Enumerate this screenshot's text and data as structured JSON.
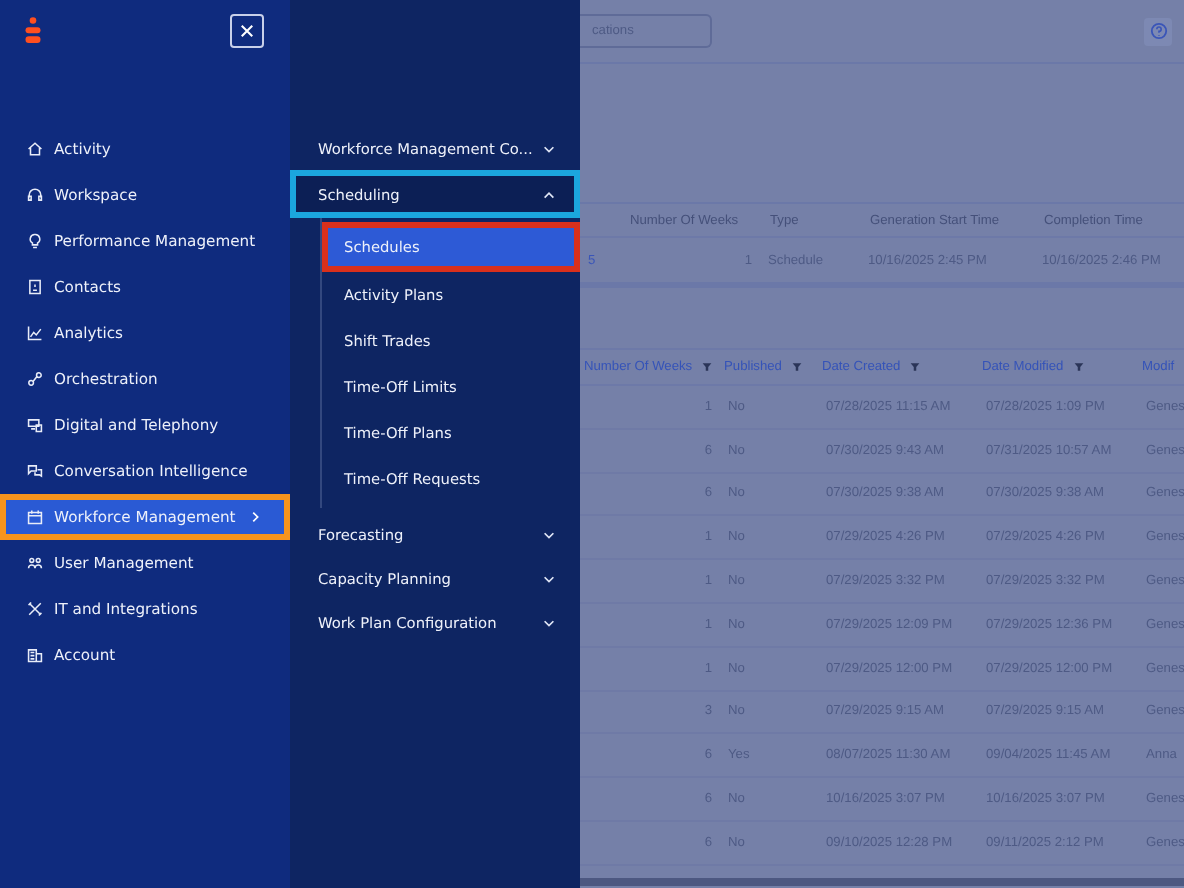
{
  "nav": {
    "items": [
      {
        "label": "Activity",
        "selected": false
      },
      {
        "label": "Workspace",
        "selected": false
      },
      {
        "label": "Performance Management",
        "selected": false
      },
      {
        "label": "Contacts",
        "selected": false
      },
      {
        "label": "Analytics",
        "selected": false
      },
      {
        "label": "Orchestration",
        "selected": false
      },
      {
        "label": "Digital and Telephony",
        "selected": false
      },
      {
        "label": "Conversation Intelligence",
        "selected": false
      },
      {
        "label": "Workforce Management",
        "selected": true,
        "color": "#f7941d"
      },
      {
        "label": "User Management",
        "selected": false
      },
      {
        "label": "IT and Integrations",
        "selected": false
      },
      {
        "label": "Account",
        "selected": false
      }
    ]
  },
  "submenu": {
    "groups": [
      {
        "label": "Workforce Management Co...",
        "expanded": false
      },
      {
        "label": "Scheduling",
        "expanded": true,
        "color": "#1ba6de",
        "children": [
          {
            "label": "Schedules",
            "selected": true,
            "color": "#d9301c"
          },
          {
            "label": "Activity Plans",
            "selected": false
          },
          {
            "label": "Shift Trades",
            "selected": false
          },
          {
            "label": "Time-Off Limits",
            "selected": false
          },
          {
            "label": "Time-Off Plans",
            "selected": false
          },
          {
            "label": "Time-Off Requests",
            "selected": false
          }
        ]
      },
      {
        "label": "Forecasting",
        "expanded": false
      },
      {
        "label": "Capacity Planning",
        "expanded": false
      },
      {
        "label": "Work Plan Configuration",
        "expanded": false
      }
    ]
  },
  "page": {
    "search": {
      "value": "cations"
    },
    "summary_table": {
      "columns": [
        "",
        "Number Of Weeks",
        "Type",
        "Generation Start Time",
        "Completion Time"
      ],
      "rows": [
        [
          "5",
          "1",
          "Schedule",
          "10/16/2025 2:45 PM",
          "10/16/2025 2:46 PM"
        ]
      ]
    },
    "schedules_table": {
      "columns": [
        "Number Of Weeks",
        "Published",
        "Date Created",
        "Date Modified",
        "Modif"
      ],
      "rows": [
        [
          "1",
          "No",
          "07/28/2025 11:15 AM",
          "07/28/2025 1:09 PM",
          "Genes"
        ],
        [
          "6",
          "No",
          "07/30/2025 9:43 AM",
          "07/31/2025 10:57 AM",
          "Genes"
        ],
        [
          "6",
          "No",
          "07/30/2025 9:38 AM",
          "07/30/2025 9:38 AM",
          "Genes"
        ],
        [
          "1",
          "No",
          "07/29/2025 4:26 PM",
          "07/29/2025 4:26 PM",
          "Genes"
        ],
        [
          "1",
          "No",
          "07/29/2025 3:32 PM",
          "07/29/2025 3:32 PM",
          "Genes"
        ],
        [
          "1",
          "No",
          "07/29/2025 12:09 PM",
          "07/29/2025 12:36 PM",
          "Genes"
        ],
        [
          "1",
          "No",
          "07/29/2025 12:00 PM",
          "07/29/2025 12:00 PM",
          "Genes"
        ],
        [
          "3",
          "No",
          "07/29/2025 9:15 AM",
          "07/29/2025 9:15 AM",
          "Genes"
        ],
        [
          "6",
          "Yes",
          "08/07/2025 11:30 AM",
          "09/04/2025 11:45 AM",
          "Anna"
        ],
        [
          "6",
          "No",
          "10/16/2025 3:07 PM",
          "10/16/2025 3:07 PM",
          "Genes"
        ],
        [
          "6",
          "No",
          "09/10/2025 12:28 PM",
          "09/11/2025 2:12 PM",
          "Genes"
        ]
      ]
    }
  }
}
